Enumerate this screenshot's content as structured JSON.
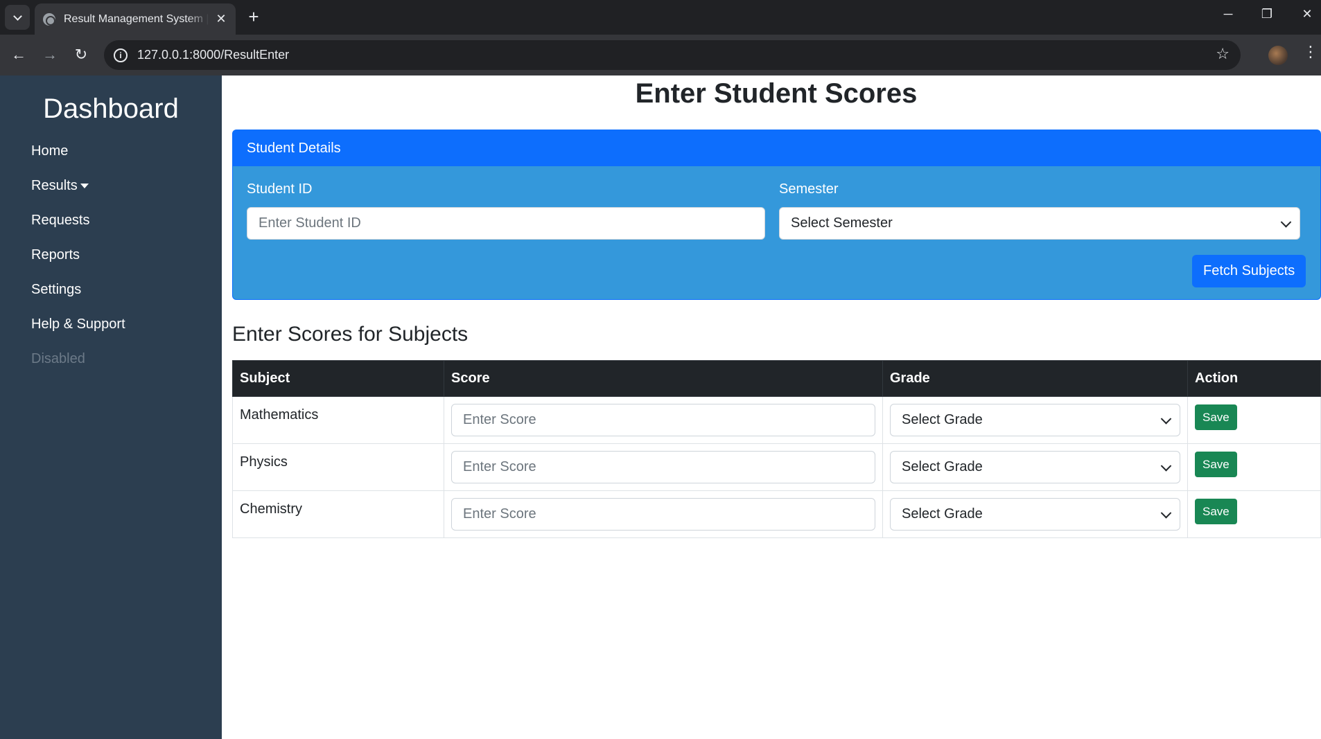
{
  "browser": {
    "tab_title": "Result Management System | Enter Result",
    "url": "127.0.0.1:8000/ResultEnter"
  },
  "sidebar": {
    "title": "Dashboard",
    "items": [
      {
        "label": "Home"
      },
      {
        "label": "Results"
      },
      {
        "label": "Requests"
      },
      {
        "label": "Reports"
      },
      {
        "label": "Settings"
      },
      {
        "label": "Help & Support"
      },
      {
        "label": "Disabled"
      }
    ]
  },
  "page": {
    "title": "Enter Student Scores"
  },
  "student_details": {
    "header": "Student Details",
    "student_id_label": "Student ID",
    "student_id_placeholder": "Enter Student ID",
    "semester_label": "Semester",
    "semester_value": "Select Semester",
    "fetch_button": "Fetch Subjects"
  },
  "scores": {
    "section_title": "Enter Scores for Subjects",
    "columns": [
      "Subject",
      "Score",
      "Grade",
      "Action"
    ],
    "rows": [
      {
        "subject": "Mathematics",
        "score_placeholder": "Enter Score",
        "grade_value": "Select Grade",
        "action": "Save"
      },
      {
        "subject": "Physics",
        "score_placeholder": "Enter Score",
        "grade_value": "Select Grade",
        "action": "Save"
      },
      {
        "subject": "Chemistry",
        "score_placeholder": "Enter Score",
        "grade_value": "Select Grade",
        "action": "Save"
      }
    ]
  },
  "colors": {
    "sidebar_bg": "#2c3e50",
    "card_header": "#0d6efd",
    "card_body": "#3498db",
    "save_button": "#198754",
    "table_header": "#212529"
  }
}
